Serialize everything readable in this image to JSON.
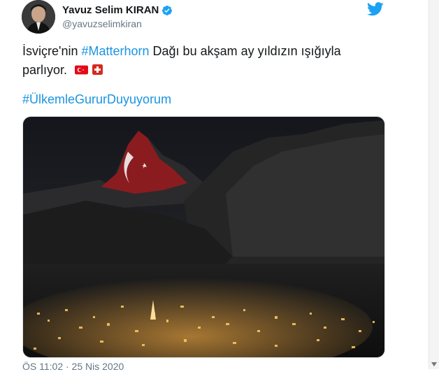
{
  "author": {
    "name": "Yavuz Selim KIRAN",
    "handle": "@yavuzselimkiran"
  },
  "tweet": {
    "text_before": "İsviçre'nin ",
    "mention_hashtag": "#Matterhorn",
    "text_after": " Dağı bu akşam ay yıldızın ışığıyla parlıyor.",
    "hashtag_line": "#ÜlkemleGururDuyuyorum",
    "timestamp": "ÖS 11:02 · 25 Nis 2020"
  },
  "icons": {
    "verified": "verified-badge-icon",
    "twitter": "twitter-bird-icon"
  },
  "colors": {
    "link": "#1b95e0",
    "verified": "#1da1f2",
    "muted": "#657786"
  }
}
